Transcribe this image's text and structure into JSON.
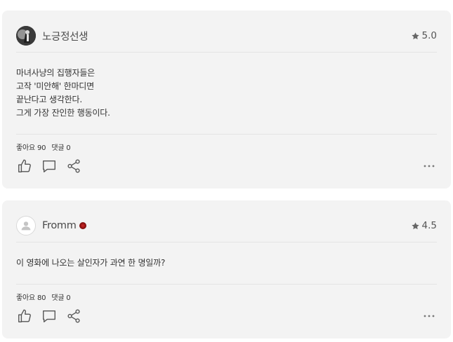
{
  "reviews": [
    {
      "username": "노긍정선생",
      "rating": "5.0",
      "text": "마녀사냥의 집행자들은\n고작 '미안해' 한마디면\n끝난다고 생각한다.\n그게 가장 잔인한 행동이다.",
      "likes": "좋아요 90",
      "comments": "댓글 0"
    },
    {
      "username": "Fromm",
      "rating": "4.5",
      "text": "이 영화에 나오는 살인자가 과연 한 명일까?",
      "likes": "좋아요 80",
      "comments": "댓글 0"
    }
  ]
}
